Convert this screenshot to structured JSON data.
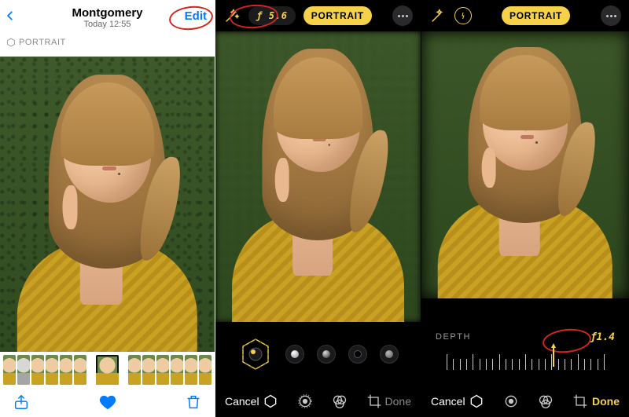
{
  "panelA": {
    "album": "Montgomery",
    "subtitle": "Today 12:55",
    "edit": "Edit",
    "badge": "PORTRAIT"
  },
  "panelB": {
    "fstop": "ƒ 5.6",
    "portrait": "PORTRAIT",
    "cancel": "Cancel",
    "done": "Done"
  },
  "panelC": {
    "portrait": "PORTRAIT",
    "depth_label": "DEPTH",
    "depth_value": "ƒ1.4",
    "cancel": "Cancel",
    "done": "Done"
  },
  "colors": {
    "accent_blue": "#007aff",
    "accent_yellow": "#f5d24a",
    "annotation_red": "#d1261f"
  }
}
